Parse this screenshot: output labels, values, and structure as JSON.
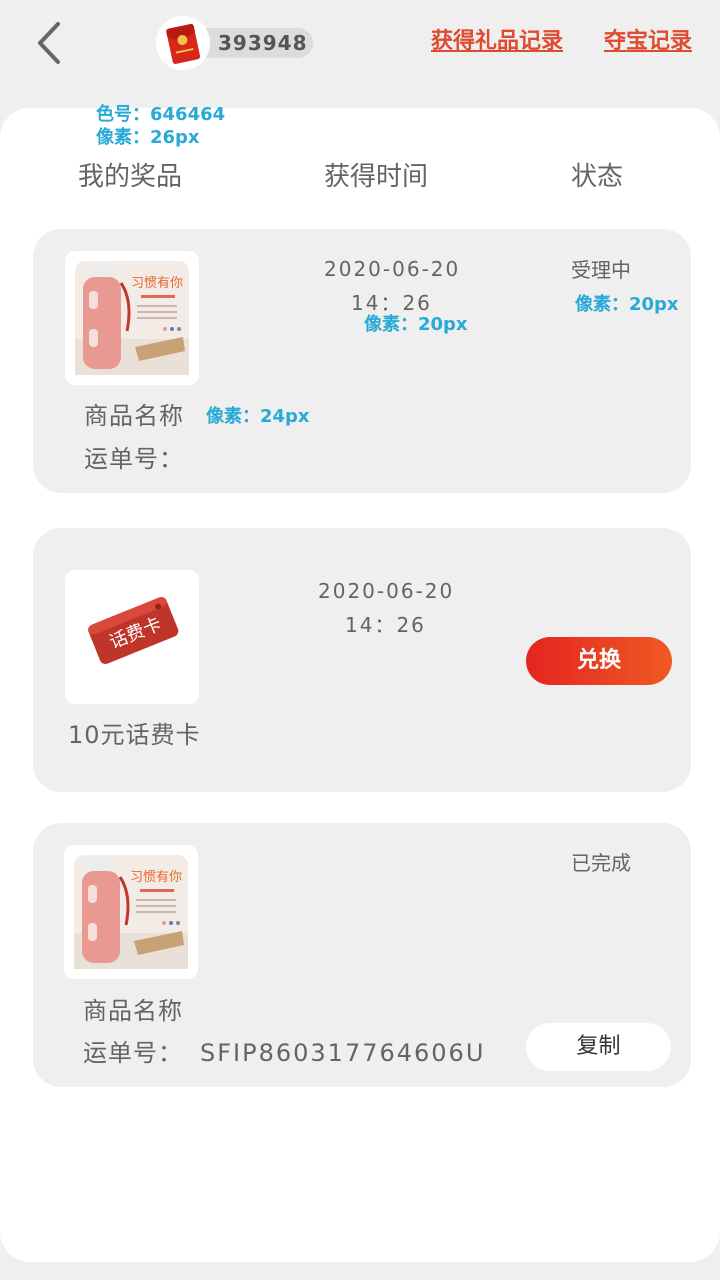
{
  "header": {
    "coin_count": "393948",
    "link_gift_records": "获得礼品记录",
    "link_treasure_records": "夺宝记录"
  },
  "annotations": {
    "color_code": "色号：646464",
    "size_26": "像素：26px",
    "size_20_status": "像素：20px",
    "size_20_time": "像素：20px",
    "size_24": "像素：24px"
  },
  "columns": {
    "prize": "我的奖品",
    "time": "获得时间",
    "status": "状态"
  },
  "records": [
    {
      "date": "2020-06-20",
      "time": "14：26",
      "status": "受理中",
      "name": "商品名称",
      "waybill_label": "运单号："
    },
    {
      "date": "2020-06-20",
      "time": "14：26",
      "name": "10元话费卡",
      "action": "兑换",
      "card_text": "话费卡"
    },
    {
      "status": "已完成",
      "name": "商品名称",
      "waybill_label": "运单号：",
      "waybill_no": "SFIP860317764606U",
      "action": "复制"
    }
  ],
  "colors": {
    "text": "#646464",
    "accent": "#e04a2e",
    "annotation": "#29a9d6"
  },
  "icons": {
    "back": "chevron-left-icon",
    "avatar": "red-envelope-icon"
  }
}
